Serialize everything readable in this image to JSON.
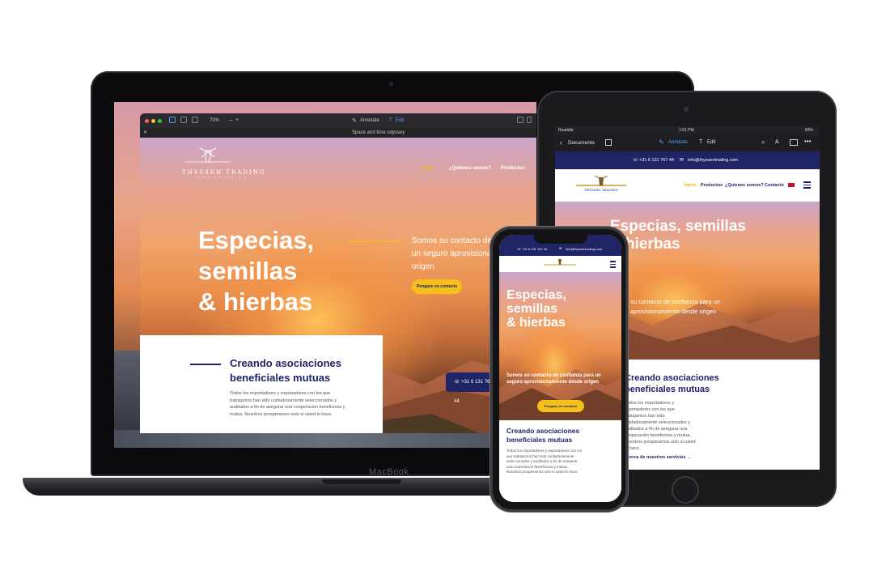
{
  "laptop": {
    "brand_label": "MacBook",
    "app": {
      "zoom": "70%",
      "annotate_label": "Annotate",
      "edit_label": "Edit",
      "doc_title": "Space and time odyssey"
    },
    "site": {
      "logo_text": "THYSSEN TRADING",
      "logo_sub": "COMMODITIES",
      "nav": [
        "Inicio",
        "¿Quienes somos?",
        "Productos"
      ],
      "hero_title_lines": [
        "Especias,",
        "semillas",
        "& hierbas"
      ],
      "hero_subtitle": "Somos su contacto de confianza para un seguro aprovisionamiento desde origen",
      "cta_label": "Póngase en contacto",
      "section_title": "Creando asociaciones beneficiales mutuas",
      "section_body": "Todos los importadores y exportadores con los que trabajamos han sido cuidadosamente seleccionados y auditados a fin de asegurar una cooperación beneficiosa y mutua. Nosotros prosperamos solo si usted lo hace.",
      "phone_button": "+31 6 131 767 44"
    }
  },
  "tablet": {
    "status": {
      "app": "Readdle",
      "time": "1:01 PM",
      "battery": "83%"
    },
    "appbar": {
      "back_label": "Documents",
      "annotate_label": "Annotate",
      "edit_label": "Edit"
    },
    "topbar": {
      "phone": "+31 6 131 767 44",
      "email": "info@thyssentrading.com"
    },
    "nav": [
      "Inicio",
      "Productos",
      "¿Quienes somos?",
      "Contacto"
    ],
    "hero_title_lines": [
      "Especias, semillas",
      "& hierbas"
    ],
    "hero_subtitle": "Somos su contacto de confianza para un seguro aprovisionamiento desde origen",
    "section_title_lines": [
      "Creando asociaciones",
      "beneficiales mutuas"
    ],
    "section_body": "Todos los importadores y exportadores con los que trabajamos han sido cuidadosamente seleccionados y auditados a fin de asegurar una cooperación beneficiosa y mutua. Nosotros prosperamos solo si usted lo hace.",
    "link_label": "acerca de nuestros servicios"
  },
  "phone": {
    "topbar": {
      "phone": "+31 6 131 767 44",
      "email": "info@thyssentrading.com"
    },
    "hero_title_lines": [
      "Especias,",
      "semillas",
      "& hierbas"
    ],
    "hero_subtitle": "Somos su contacto de confianza para un seguro aprovisionamiento desde origen",
    "cta_label": "Póngase en contacto",
    "section_title": "Creando asociaciones beneficiales mutuas",
    "section_body": "Todos los importadores y exportadores con los que trabajamos han sido cuidadosamente seleccionados y auditados a fin de asegurar una cooperación beneficiosa y mutua. Nosotros prosperamos solo si usted lo hace."
  },
  "colors": {
    "navy": "#1f2466",
    "accent": "#f5c01a",
    "active_nav": "#f5b400"
  }
}
